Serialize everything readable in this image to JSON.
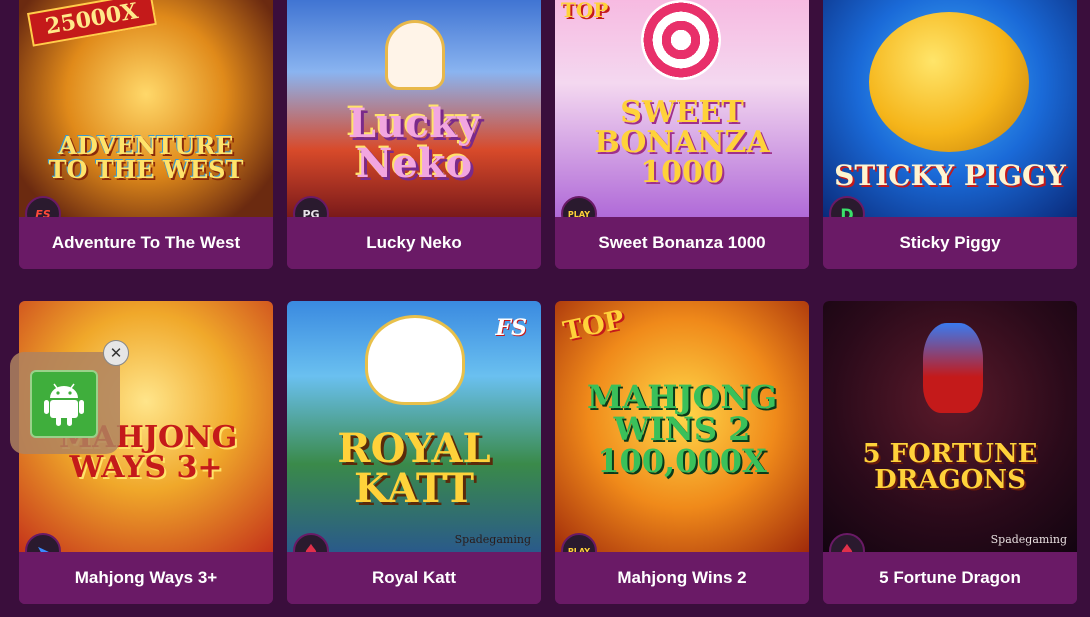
{
  "games": [
    {
      "name": "Adventure To The West",
      "art_title": "ADVENTURE TO THE WEST",
      "badge": "25000X",
      "provider_icon": "fastspin-icon",
      "provider_text": "FS"
    },
    {
      "name": "Lucky Neko",
      "art_title": "Lucky Neko",
      "provider_icon": "pg-soft-icon",
      "provider_text": "PG"
    },
    {
      "name": "Sweet Bonanza 1000",
      "art_title": "SWEET BONANZA 1000",
      "badge": "TOP",
      "provider_icon": "pragmatic-play-icon",
      "provider_text": "PLAY"
    },
    {
      "name": "Sticky Piggy",
      "art_title": "STICKY PIGGY",
      "provider_icon": "dragoon-soft-icon",
      "provider_text": "D"
    },
    {
      "name": "Mahjong Ways 3+",
      "art_title": "MAHJONG WAYS 3+",
      "provider_icon": "jili-icon",
      "provider_text": "➤"
    },
    {
      "name": "Royal Katt",
      "art_title": "ROYAL KATT",
      "badge": "FS",
      "sub_brand": "Spadegaming",
      "provider_icon": "spadegaming-icon",
      "provider_text": "♠"
    },
    {
      "name": "Mahjong Wins 2",
      "art_title": "MAHJONG WINS 2 100,000X",
      "badge": "TOP",
      "provider_icon": "pragmatic-play-icon",
      "provider_text": "PLAY"
    },
    {
      "name": "5 Fortune Dragon",
      "art_title": "5 FORTUNE DRAGONS",
      "sub_brand": "Spadegaming",
      "provider_icon": "spadegaming-icon",
      "provider_text": "♠"
    }
  ],
  "app_widget": {
    "icon": "android-icon",
    "close_icon": "close-icon",
    "close_glyph": "✕"
  },
  "colors": {
    "page_bg": "#3a0e3c",
    "card_bg": "#6a1a66",
    "caption_text": "#ffffff",
    "android_green": "#3fae3c"
  }
}
